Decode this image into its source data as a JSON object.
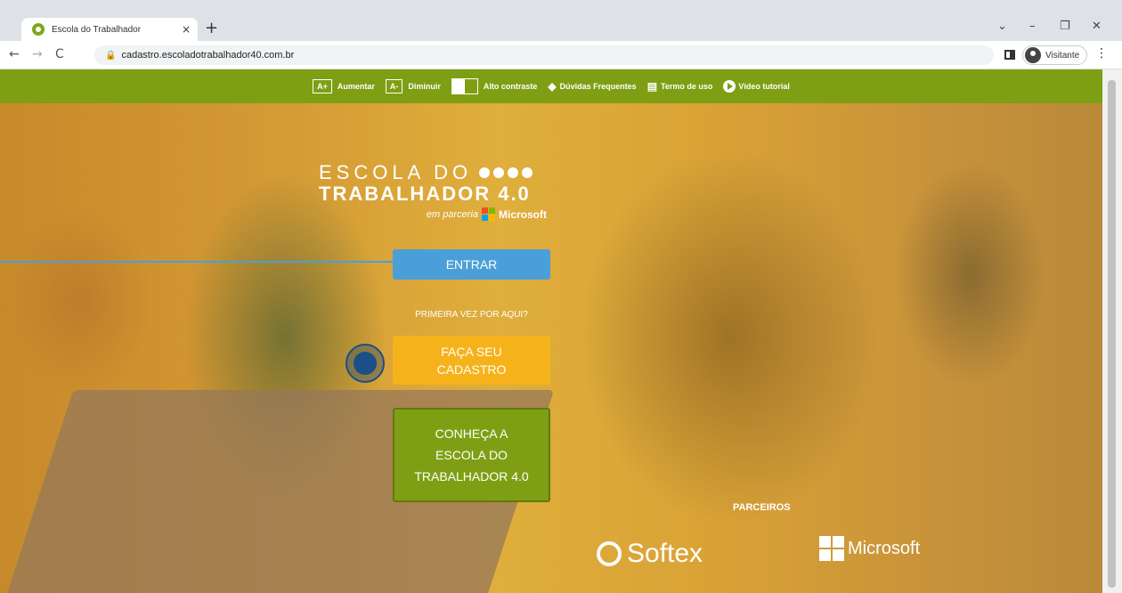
{
  "browser": {
    "tab_title": "Escola do Trabalhador",
    "tab_close": "×",
    "new_tab": "+",
    "url": "cadastro.escoladotrabalhador40.com.br",
    "profile_name": "Visitante",
    "back": "←",
    "forward": "→",
    "reload": "C",
    "menu": "⋮",
    "minimize": "–",
    "restore": "❐",
    "close": "✕",
    "dropdown": "⌄"
  },
  "accessibility_bar": {
    "increase_box": "A+",
    "increase_label": "Aumentar",
    "decrease_box": "A-",
    "decrease_label": "Diminuir",
    "contrast_label": "Alto contraste",
    "faq_label": "Dúvidas Frequentes",
    "terms_label": "Termo de uso",
    "video_label": "Vídeo tutorial"
  },
  "logo": {
    "line1": "ESCOLA DO",
    "line2": "TRABALHADOR 4.0",
    "partnership": "em parceria",
    "partner": "Microsoft"
  },
  "actions": {
    "entrar": "ENTRAR",
    "first_time": "PRIMEIRA VEZ POR AQUI?",
    "cadastro_line1": "FAÇA SEU",
    "cadastro_line2": "CADASTRO",
    "conheca": "CONHEÇA A ESCOLA DO TRABALHADOR 4.0"
  },
  "partners": {
    "heading": "PARCEIROS",
    "softex": "Softex",
    "microsoft": "Microsoft"
  },
  "colors": {
    "brand_green": "#7e9f14",
    "entrar_blue": "#4a9fd8",
    "cadastro_yellow": "#f6b21b"
  }
}
